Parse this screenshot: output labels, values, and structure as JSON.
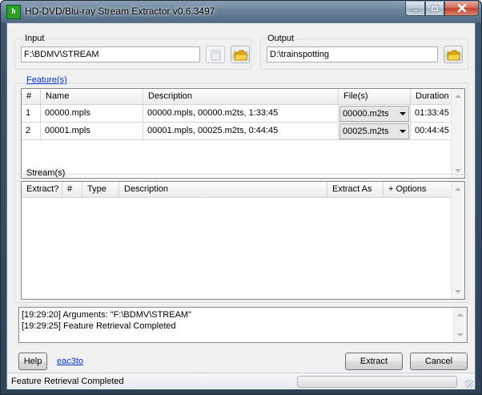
{
  "window": {
    "title": "HD-DVD/Blu-ray Stream Extractor v0.6.3497",
    "icon_label": "h"
  },
  "input": {
    "label": "Input",
    "value": "F:\\BDMV\\STREAM"
  },
  "output": {
    "label": "Output",
    "value": "D:\\trainspotting"
  },
  "features": {
    "label": "Feature(s)",
    "columns": [
      "#",
      "Name",
      "Description",
      "File(s)",
      "Duration"
    ],
    "rows": [
      {
        "num": "1",
        "name": "00000.mpls",
        "description": "00000.mpls, 00000.m2ts, 1:33:45",
        "file": "00000.m2ts",
        "duration": "01:33:45"
      },
      {
        "num": "2",
        "name": "00001.mpls",
        "description": "00001.mpls, 00025.m2ts, 0:44:45",
        "file": "00025.m2ts",
        "duration": "00:44:45"
      }
    ]
  },
  "streams": {
    "label": "Stream(s)",
    "columns": [
      "Extract?",
      "#",
      "Type",
      "Description",
      "Extract As",
      "+ Options"
    ]
  },
  "log": {
    "lines": [
      "[19:29:20] Arguments: \"F:\\BDMV\\STREAM\"",
      "[19:29:25] Feature Retrieval Completed"
    ]
  },
  "buttons": {
    "help": "Help",
    "eac3to": "eac3to",
    "extract": "Extract",
    "cancel": "Cancel"
  },
  "status": {
    "text": "Feature Retrieval Completed",
    "progress": 0
  },
  "icons": {
    "folder": "folder-icon",
    "disc": "disc-drive-icon"
  },
  "colors": {
    "link": "#0033cc",
    "folder": "#f3c22b"
  }
}
